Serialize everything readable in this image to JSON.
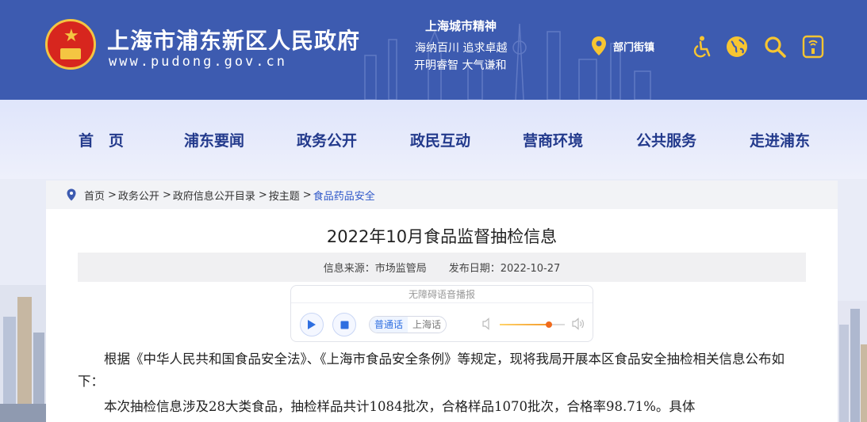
{
  "header": {
    "site_title": "上海市浦东新区人民政府",
    "site_url": "www.pudong.gov.cn",
    "spirit_title": "上海城市精神",
    "spirit_line1": "海纳百川  追求卓越",
    "spirit_line2": "开明睿智  大气谦和",
    "dept_link": "部门街镇",
    "icons": [
      "accessibility-icon",
      "globe-icon",
      "search-icon",
      "mobile-icon"
    ]
  },
  "nav": {
    "items": [
      "首　页",
      "浦东要闻",
      "政务公开",
      "政民互动",
      "营商环境",
      "公共服务",
      "走进浦东"
    ]
  },
  "breadcrumb": {
    "items": [
      "首页",
      "政务公开",
      "政府信息公开目录",
      "按主题",
      "食品药品安全"
    ],
    "separator": ">"
  },
  "article": {
    "title": "2022年10月食品监督抽检信息",
    "source": "信息来源：市场监管局",
    "date": "发布日期：2022-10-27",
    "para1": "根据《中华人民共和国食品安全法》、《上海市食品安全条例》等规定，现将我局开展本区食品安全抽检相关信息公布如下：",
    "para2": "本次抽检信息涉及28大类食品，抽检样品共计1084批次，合格样品1070批次，合格率98.71%。具体"
  },
  "player": {
    "header": "无障碍语音播报",
    "lang_active": "普通话",
    "lang_other": "上海话",
    "volume_fraction": 0.75
  },
  "colors": {
    "header_bg": "#3d5bb0",
    "nav_text": "#233a8c",
    "breadcrumb_current": "#2f58c9",
    "volume_knob": "#f06a1c"
  }
}
